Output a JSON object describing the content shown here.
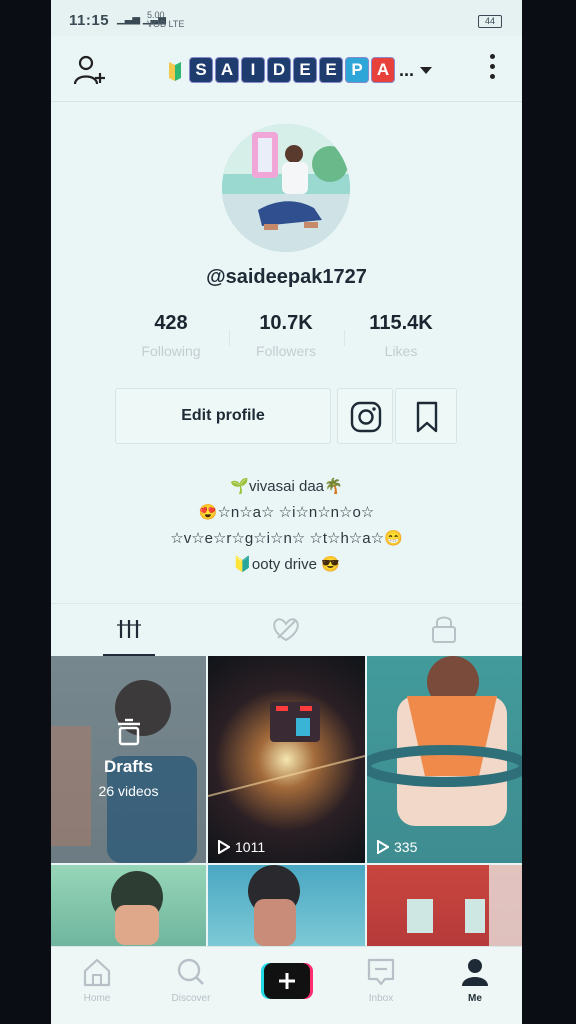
{
  "status_bar": {
    "time": "11:15",
    "network_top": "5.00",
    "network_bottom": "VOB LTE",
    "battery": "44"
  },
  "header": {
    "title_letters": [
      "S",
      "A",
      "I",
      "D",
      "E",
      "E",
      "P",
      "A"
    ],
    "title_more": "...",
    "add_user_icon": "add-person-icon",
    "menu_icon": "vertical-dots-icon"
  },
  "profile": {
    "username": "@saideepak1727",
    "stats": [
      {
        "value": "428",
        "label": "Following"
      },
      {
        "value": "10.7K",
        "label": "Followers"
      },
      {
        "value": "115.4K",
        "label": "Likes"
      }
    ],
    "edit_profile_label": "Edit profile",
    "bio_lines": [
      "🌱vivasai daa🌴",
      "😍☆n☆a☆ ☆i☆n☆n☆o☆",
      "☆v☆e☆r☆g☆i☆n☆ ☆t☆h☆a☆😁",
      "🔰ooty drive 😎"
    ]
  },
  "tabs": [
    "videos-grid-icon",
    "liked-icon",
    "private-lock-icon"
  ],
  "grid": {
    "drafts_title": "Drafts",
    "drafts_subtitle": "26 videos",
    "video_views": [
      "1011",
      "335"
    ]
  },
  "bottom_nav": {
    "items": [
      {
        "label": "Home",
        "icon": "home-icon"
      },
      {
        "label": "Discover",
        "icon": "search-icon"
      },
      {
        "label": "",
        "icon": "plus-icon"
      },
      {
        "label": "Inbox",
        "icon": "inbox-icon"
      },
      {
        "label": "Me",
        "icon": "person-icon"
      }
    ]
  },
  "colors": {
    "background": "#eaf6f5",
    "text": "#1e2b36",
    "muted": "#c4ccd1"
  }
}
